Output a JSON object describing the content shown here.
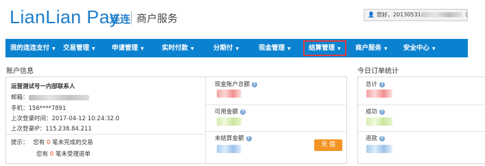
{
  "brand": {
    "logo_text": "LianLian Pay",
    "logo_cn": "连连",
    "subtitle": "商户服务"
  },
  "user": {
    "greeting": "您好，20130531",
    "role": "（管理员）"
  },
  "nav": {
    "items": [
      {
        "label": "我的连连支付",
        "caret": false
      },
      {
        "label": "交易管理",
        "caret": true
      },
      {
        "label": "申请管理",
        "caret": true
      },
      {
        "label": "实时付款",
        "caret": true
      },
      {
        "label": "分期付",
        "caret": true
      },
      {
        "label": "现金管理",
        "caret": true
      },
      {
        "label": "结算管理",
        "caret": true,
        "highlighted": true
      },
      {
        "label": "商户服务",
        "caret": true
      },
      {
        "label": "安全中心",
        "caret": true
      }
    ],
    "caret_glyph": "▼"
  },
  "account": {
    "section_title": "账户信息",
    "merchant_name": "运营测试号一内部联系人",
    "email_label": "邮箱：",
    "phone": "手机：156****7891",
    "last_login_time": "上次登录时间：2017-04-12 10:24:32.0",
    "last_login_ip": "上次登录IP：115.238.84.211",
    "tip_label": "提示：",
    "tip_line1_prefix": "您有",
    "tip_line1_count": "0",
    "tip_line1_suffix": "笔未完成的交易",
    "tip_line2_prefix": "您有",
    "tip_line2_count": "0",
    "tip_line2_suffix": "笔未受理退单"
  },
  "balances": {
    "total_label": "现金账户总额",
    "available_label": "可用金额",
    "unsettled_label": "未结算金额",
    "charge_button": "充 值",
    "help_glyph": "?"
  },
  "orders": {
    "section_title": "今日订单统计",
    "total_label": "总计",
    "success_label": "成功",
    "refund_label": "退款"
  },
  "colors": {
    "brand_blue": "#1e7ecb",
    "nav_bg": "#0b82d0",
    "highlight_border": "#e23b3b",
    "charge_orange": "#f39425",
    "count_red": "#e0471b"
  }
}
